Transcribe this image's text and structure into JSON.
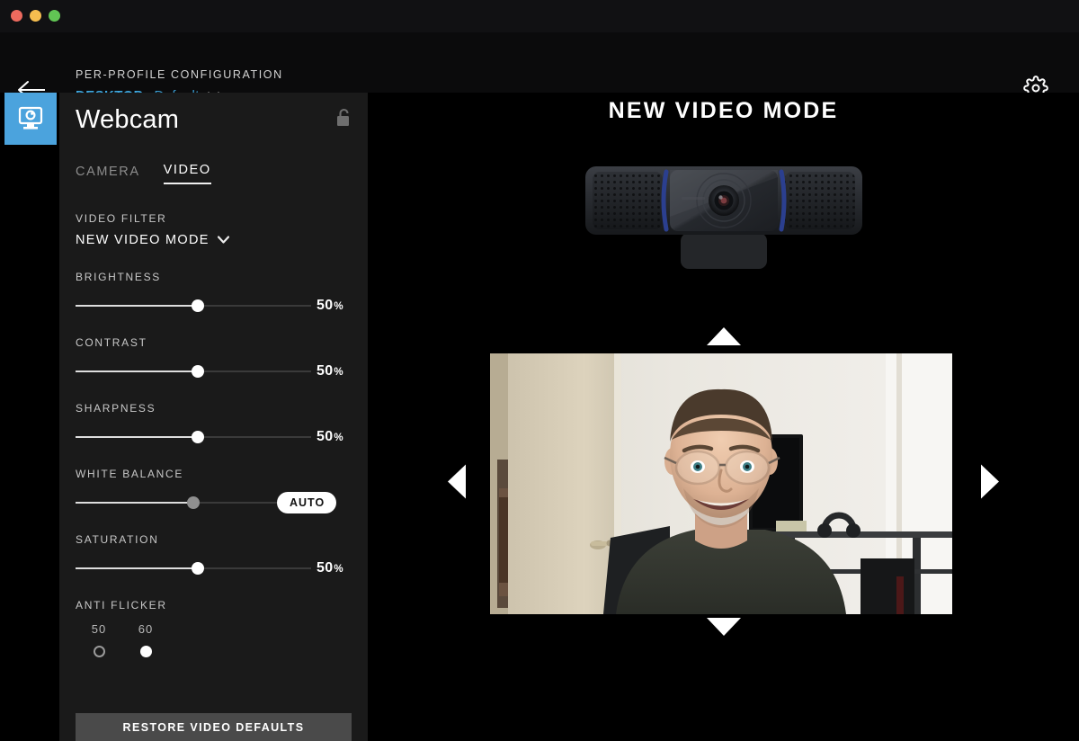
{
  "window": {
    "traffic_lights": [
      "close",
      "minimize",
      "zoom"
    ],
    "colors": {
      "close": "#ed6a5e",
      "minimize": "#f5bd4f",
      "zoom": "#61c554"
    }
  },
  "header": {
    "back_icon": "arrow-left-icon",
    "kicker": "PER-PROFILE CONFIGURATION",
    "profile_label": "DESKTOP:",
    "profile_value": "Default",
    "profile_caret": "❯",
    "settings_icon": "gear-icon",
    "accent_color": "#3ea8e0"
  },
  "nav": {
    "items": [
      {
        "name": "webcam",
        "icon": "webcam-icon",
        "active": true,
        "color": "#4ba3dd"
      }
    ]
  },
  "panel": {
    "title": "Webcam",
    "lock_icon": "unlocked-padlock-icon",
    "tabs": [
      {
        "label": "CAMERA",
        "active": false
      },
      {
        "label": "VIDEO",
        "active": true
      }
    ],
    "filter": {
      "label": "VIDEO FILTER",
      "value": "NEW VIDEO MODE",
      "caret": "❯"
    },
    "sliders": [
      {
        "label": "BRIGHTNESS",
        "value": "50",
        "unit": "%",
        "percent": 52,
        "disabled": false
      },
      {
        "label": "CONTRAST",
        "value": "50",
        "unit": "%",
        "percent": 52,
        "disabled": false
      },
      {
        "label": "SHARPNESS",
        "value": "50",
        "unit": "%",
        "percent": 52,
        "disabled": false
      },
      {
        "label": "WHITE BALANCE",
        "value": "AUTO",
        "unit": "",
        "percent": 50,
        "disabled": true
      },
      {
        "label": "SATURATION",
        "value": "50",
        "unit": "%",
        "percent": 52,
        "disabled": false
      }
    ],
    "white_balance_auto_label": "AUTO",
    "anti_flicker": {
      "label": "ANTI FLICKER",
      "options": [
        {
          "label": "50",
          "selected": false
        },
        {
          "label": "60",
          "selected": true
        }
      ]
    },
    "restore_button": "RESTORE VIDEO DEFAULTS"
  },
  "preview": {
    "mode_title": "NEW VIDEO MODE",
    "device_icon": "webcam-device-illustration",
    "pan_tilt": {
      "up": "arrow-up-icon",
      "down": "arrow-down-icon",
      "left": "arrow-left-icon",
      "right": "arrow-right-icon"
    },
    "video_feed": "live-camera-preview"
  }
}
